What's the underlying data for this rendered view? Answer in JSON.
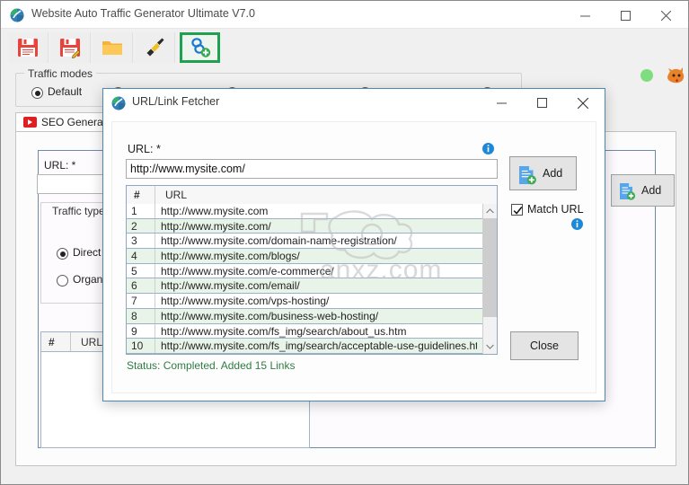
{
  "app": {
    "title": "Website Auto Traffic Generator Ultimate V7.0",
    "icon": "app-globe-icon",
    "window_controls": {
      "minimize": "minimize-icon",
      "maximize": "maximize-icon",
      "close": "close-icon"
    },
    "status_indicator_color": "#7fdd7f"
  },
  "toolbar": {
    "buttons": [
      {
        "name": "save-icon",
        "tooltip": "Save"
      },
      {
        "name": "save-as-icon",
        "tooltip": "Save As"
      },
      {
        "name": "open-folder-icon",
        "tooltip": "Open"
      },
      {
        "name": "flashlight-icon",
        "tooltip": "Tools"
      },
      {
        "name": "link-fetcher-icon",
        "tooltip": "URL/Link Fetcher"
      }
    ],
    "active_index": 4,
    "highlight_color": "#22a052",
    "mascot_icon": "dragon-icon"
  },
  "traffic_modes": {
    "legend": "Traffic modes",
    "options": [
      {
        "label": "Default",
        "selected": true
      },
      {
        "label": "",
        "selected": false
      },
      {
        "label": "",
        "selected": false
      },
      {
        "label": "",
        "selected": false
      },
      {
        "label": "",
        "selected": false
      }
    ]
  },
  "tabs": [
    {
      "label": "SEO General T",
      "icon": "play-icon",
      "active": true
    }
  ],
  "background_panel": {
    "url_label": "URL: *",
    "url_value": "",
    "add_label": "Add",
    "add_icon": "add-document-icon",
    "traffic_type": {
      "legend": "Traffic type",
      "options": [
        {
          "label": "Direct",
          "selected": true
        },
        {
          "label": "Organ",
          "selected": false
        }
      ]
    },
    "table": {
      "columns": [
        "#",
        "URL"
      ],
      "rows": []
    }
  },
  "dialog": {
    "title": "URL/Link Fetcher",
    "icon": "app-globe-icon",
    "window_controls": {
      "minimize": "minimize-icon",
      "maximize": "maximize-icon",
      "close": "close-icon"
    },
    "url_label": "URL: *",
    "url_value": "http://www.mysite.com/",
    "url_placeholder": "http://www.mysite.com/",
    "info_icon": "info-icon",
    "add_button": {
      "label": "Add",
      "icon": "add-document-icon"
    },
    "match_url": {
      "label": "Match URL",
      "checked": true
    },
    "close_button": {
      "label": "Close"
    },
    "status": "Status: Completed. Added 15 Links",
    "status_color": "#2e7d43",
    "grid": {
      "columns": [
        "#",
        "URL"
      ],
      "rows": [
        {
          "num": "1",
          "url": "http://www.mysite.com"
        },
        {
          "num": "2",
          "url": "http://www.mysite.com/"
        },
        {
          "num": "3",
          "url": "http://www.mysite.com/domain-name-registration/"
        },
        {
          "num": "4",
          "url": "http://www.mysite.com/blogs/"
        },
        {
          "num": "5",
          "url": "http://www.mysite.com/e-commerce/"
        },
        {
          "num": "6",
          "url": "http://www.mysite.com/email/"
        },
        {
          "num": "7",
          "url": "http://www.mysite.com/vps-hosting/"
        },
        {
          "num": "8",
          "url": "http://www.mysite.com/business-web-hosting/"
        },
        {
          "num": "9",
          "url": "http://www.mysite.com/fs_img/search/about_us.htm"
        },
        {
          "num": "10",
          "url": "http://www.mysite.com/fs_img/search/acceptable-use-guidelines.ht"
        }
      ],
      "scrollbar": {
        "up_icon": "chevron-up-icon",
        "down_icon": "chevron-down-icon"
      }
    }
  },
  "watermark": {
    "text": "anxz.com",
    "mark_icon": "camera-watermark-icon"
  }
}
